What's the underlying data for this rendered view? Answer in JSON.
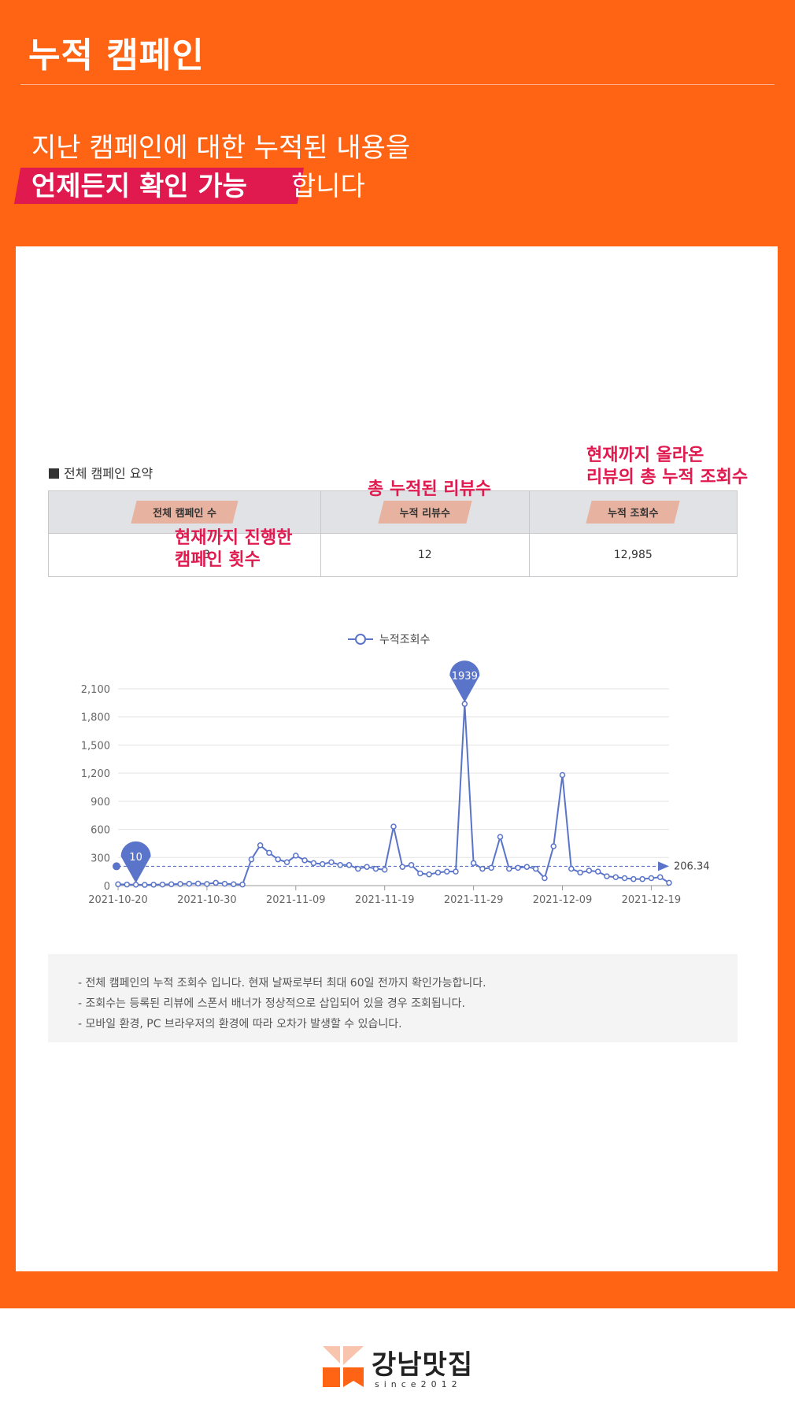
{
  "header": {
    "title": "누적 캠페인"
  },
  "intro": {
    "line1": "지난 캠페인에 대한 누적된 내용을",
    "highlight": "언제든지 확인 가능",
    "tail": "합니다"
  },
  "summary": {
    "heading": "전체 캠페인 요약",
    "columns": [
      "전체 캠페인 수",
      "누적 리뷰수",
      "누적 조회수"
    ],
    "values": [
      "3",
      "12",
      "12,985"
    ]
  },
  "annotations": {
    "campaigns": [
      "현재까지 진행한",
      "캠페인 횟수"
    ],
    "reviews": [
      "총 누적된 리뷰수"
    ],
    "views": [
      "현재까지 올라온",
      "리뷰의 총 누적 조회수"
    ]
  },
  "chart_data": {
    "type": "line",
    "legend": "누적조회수",
    "ylim": [
      0,
      2100
    ],
    "yticks": [
      "0",
      "300",
      "600",
      "900",
      "1,200",
      "1,500",
      "1,800",
      "2,100"
    ],
    "xticks": [
      "2021-10-20",
      "2021-10-30",
      "2021-11-09",
      "2021-11-19",
      "2021-11-29",
      "2021-12-09",
      "2021-12-19"
    ],
    "series": [
      {
        "name": "누적조회수",
        "values": [
          15,
          12,
          10,
          8,
          10,
          12,
          15,
          18,
          20,
          22,
          18,
          30,
          20,
          15,
          12,
          280,
          430,
          350,
          280,
          250,
          320,
          270,
          240,
          230,
          250,
          220,
          220,
          180,
          200,
          180,
          170,
          630,
          200,
          220,
          130,
          120,
          140,
          150,
          150,
          1939,
          240,
          180,
          190,
          520,
          180,
          190,
          200,
          180,
          80,
          420,
          1180,
          180,
          140,
          160,
          150,
          100,
          90,
          80,
          70,
          70,
          80,
          90,
          30
        ],
        "color": "#5a74c9"
      }
    ],
    "min_marker": {
      "label": "10",
      "index": 2
    },
    "max_marker": {
      "label": "1939",
      "index": 39
    },
    "average": {
      "label": "206.34",
      "value": 206.34
    }
  },
  "notes": [
    "- 전체 캠페인의 누적 조회수 입니다. 현재 날짜로부터 최대 60일 전까지 확인가능합니다.",
    "- 조회수는 등록된 리뷰에 스폰서 배너가 정상적으로 삽입되어 있을 경우 조회됩니다.",
    "- 모바일 환경, PC 브라우저의 환경에 따라 오차가 발생할 수 있습니다."
  ],
  "footer": {
    "brand": "강남맛집",
    "since": "since2012"
  }
}
